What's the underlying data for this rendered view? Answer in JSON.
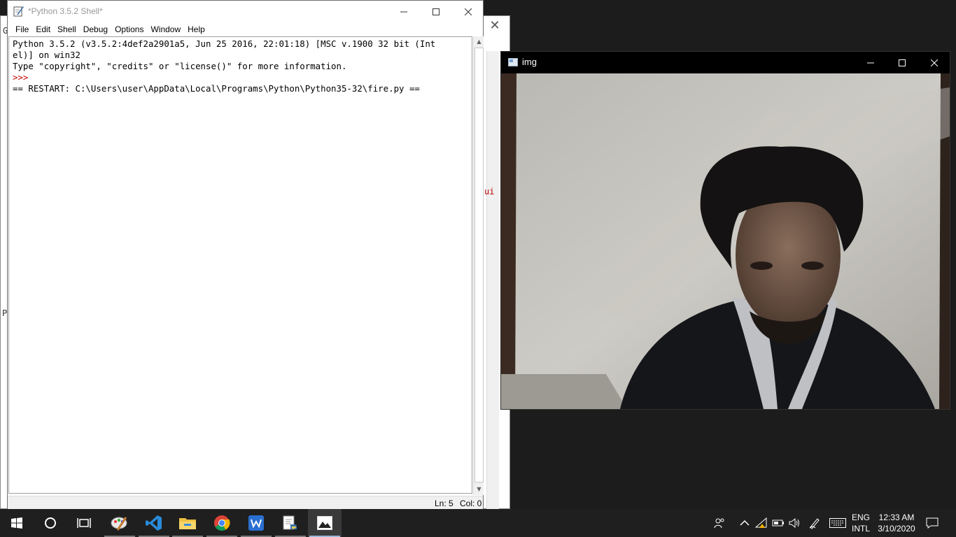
{
  "background_window": {
    "close_glyph": "✕",
    "fragments": [
      "G",
      "ui",
      "P",
      "P"
    ]
  },
  "shell": {
    "title": "*Python 3.5.2 Shell*",
    "menu": [
      "File",
      "Edit",
      "Shell",
      "Debug",
      "Options",
      "Window",
      "Help"
    ],
    "lines": [
      "Python 3.5.2 (v3.5.2:4def2a2901a5, Jun 25 2016, 22:01:18) [MSC v.1900 32 bit (Int",
      "el)] on win32",
      "Type \"copyright\", \"credits\" or \"license()\" for more information."
    ],
    "prompt": ">>> ",
    "restart_line": "== RESTART: C:\\Users\\user\\AppData\\Local\\Programs\\Python\\Python35-32\\fire.py ==",
    "status": {
      "line": "Ln: 5",
      "col": "Col: 0"
    }
  },
  "image_window": {
    "title": "img"
  },
  "taskbar": {
    "apps": [
      "start-icon",
      "cortana-icon",
      "task-view-icon",
      "paint-icon",
      "vscode-icon",
      "file-explorer-icon",
      "chrome-icon",
      "wps-writer-icon",
      "python-idle-icon",
      "image-viewer-icon"
    ],
    "tray": {
      "language_top": "ENG",
      "language_bottom": "INTL",
      "time": "12:33 AM",
      "date": "3/10/2020"
    }
  },
  "colors": {
    "prompt": "#c00000",
    "taskbar": "#1f1f1f",
    "desktop": "#1c1c1c"
  }
}
